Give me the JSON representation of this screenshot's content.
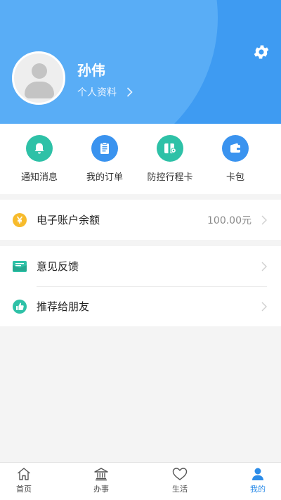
{
  "profile": {
    "name": "孙伟",
    "link_label": "个人资料"
  },
  "quick_actions": [
    {
      "label": "通知消息",
      "icon": "bell-icon",
      "color": "#2ec1a7"
    },
    {
      "label": "我的订单",
      "icon": "order-list-icon",
      "color": "#3a93ef"
    },
    {
      "label": "防控行程卡",
      "icon": "travel-card-icon",
      "color": "#2ec1a7"
    },
    {
      "label": "卡包",
      "icon": "wallet-icon",
      "color": "#3a93ef"
    }
  ],
  "balance": {
    "label": "电子账户余额",
    "value": "100.00元",
    "icon": "yen-coin-icon",
    "color": "#f7bb2c"
  },
  "menu": [
    {
      "label": "意见反馈",
      "icon": "feedback-icon",
      "color": "#2ec1a7"
    },
    {
      "label": "推荐给朋友",
      "icon": "thumbs-up-icon",
      "color": "#2ec1a7"
    }
  ],
  "tabs": [
    {
      "label": "首页",
      "icon": "home-icon",
      "active": false
    },
    {
      "label": "办事",
      "icon": "government-building-icon",
      "active": false
    },
    {
      "label": "生活",
      "icon": "heart-icon",
      "active": false
    },
    {
      "label": "我的",
      "icon": "person-icon",
      "active": true
    }
  ],
  "colors": {
    "header": "#3e9bf2",
    "accent": "#2c8ce8"
  }
}
